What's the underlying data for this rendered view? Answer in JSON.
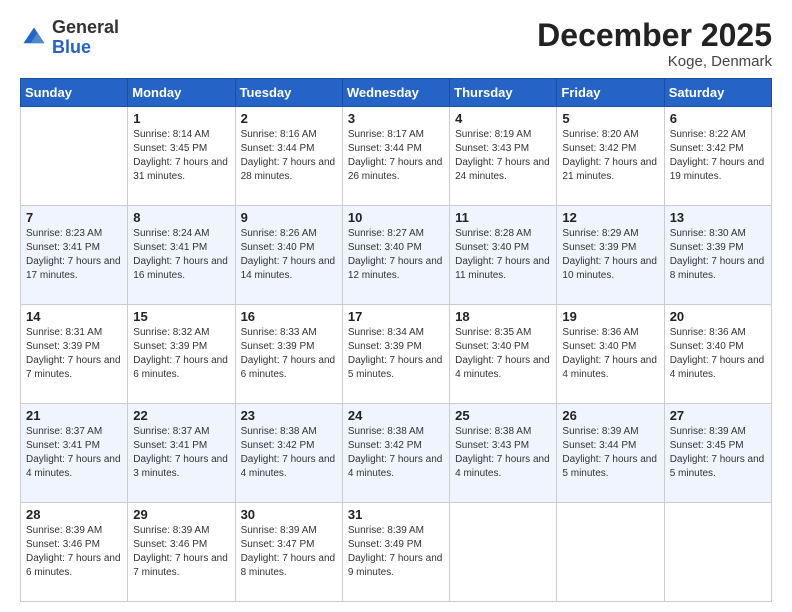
{
  "header": {
    "logo_general": "General",
    "logo_blue": "Blue",
    "month_title": "December 2025",
    "location": "Koge, Denmark"
  },
  "days_of_week": [
    "Sunday",
    "Monday",
    "Tuesday",
    "Wednesday",
    "Thursday",
    "Friday",
    "Saturday"
  ],
  "weeks": [
    [
      {
        "day": "",
        "sunrise": "",
        "sunset": "",
        "daylight": ""
      },
      {
        "day": "1",
        "sunrise": "Sunrise: 8:14 AM",
        "sunset": "Sunset: 3:45 PM",
        "daylight": "Daylight: 7 hours and 31 minutes."
      },
      {
        "day": "2",
        "sunrise": "Sunrise: 8:16 AM",
        "sunset": "Sunset: 3:44 PM",
        "daylight": "Daylight: 7 hours and 28 minutes."
      },
      {
        "day": "3",
        "sunrise": "Sunrise: 8:17 AM",
        "sunset": "Sunset: 3:44 PM",
        "daylight": "Daylight: 7 hours and 26 minutes."
      },
      {
        "day": "4",
        "sunrise": "Sunrise: 8:19 AM",
        "sunset": "Sunset: 3:43 PM",
        "daylight": "Daylight: 7 hours and 24 minutes."
      },
      {
        "day": "5",
        "sunrise": "Sunrise: 8:20 AM",
        "sunset": "Sunset: 3:42 PM",
        "daylight": "Daylight: 7 hours and 21 minutes."
      },
      {
        "day": "6",
        "sunrise": "Sunrise: 8:22 AM",
        "sunset": "Sunset: 3:42 PM",
        "daylight": "Daylight: 7 hours and 19 minutes."
      }
    ],
    [
      {
        "day": "7",
        "sunrise": "Sunrise: 8:23 AM",
        "sunset": "Sunset: 3:41 PM",
        "daylight": "Daylight: 7 hours and 17 minutes."
      },
      {
        "day": "8",
        "sunrise": "Sunrise: 8:24 AM",
        "sunset": "Sunset: 3:41 PM",
        "daylight": "Daylight: 7 hours and 16 minutes."
      },
      {
        "day": "9",
        "sunrise": "Sunrise: 8:26 AM",
        "sunset": "Sunset: 3:40 PM",
        "daylight": "Daylight: 7 hours and 14 minutes."
      },
      {
        "day": "10",
        "sunrise": "Sunrise: 8:27 AM",
        "sunset": "Sunset: 3:40 PM",
        "daylight": "Daylight: 7 hours and 12 minutes."
      },
      {
        "day": "11",
        "sunrise": "Sunrise: 8:28 AM",
        "sunset": "Sunset: 3:40 PM",
        "daylight": "Daylight: 7 hours and 11 minutes."
      },
      {
        "day": "12",
        "sunrise": "Sunrise: 8:29 AM",
        "sunset": "Sunset: 3:39 PM",
        "daylight": "Daylight: 7 hours and 10 minutes."
      },
      {
        "day": "13",
        "sunrise": "Sunrise: 8:30 AM",
        "sunset": "Sunset: 3:39 PM",
        "daylight": "Daylight: 7 hours and 8 minutes."
      }
    ],
    [
      {
        "day": "14",
        "sunrise": "Sunrise: 8:31 AM",
        "sunset": "Sunset: 3:39 PM",
        "daylight": "Daylight: 7 hours and 7 minutes."
      },
      {
        "day": "15",
        "sunrise": "Sunrise: 8:32 AM",
        "sunset": "Sunset: 3:39 PM",
        "daylight": "Daylight: 7 hours and 6 minutes."
      },
      {
        "day": "16",
        "sunrise": "Sunrise: 8:33 AM",
        "sunset": "Sunset: 3:39 PM",
        "daylight": "Daylight: 7 hours and 6 minutes."
      },
      {
        "day": "17",
        "sunrise": "Sunrise: 8:34 AM",
        "sunset": "Sunset: 3:39 PM",
        "daylight": "Daylight: 7 hours and 5 minutes."
      },
      {
        "day": "18",
        "sunrise": "Sunrise: 8:35 AM",
        "sunset": "Sunset: 3:40 PM",
        "daylight": "Daylight: 7 hours and 4 minutes."
      },
      {
        "day": "19",
        "sunrise": "Sunrise: 8:36 AM",
        "sunset": "Sunset: 3:40 PM",
        "daylight": "Daylight: 7 hours and 4 minutes."
      },
      {
        "day": "20",
        "sunrise": "Sunrise: 8:36 AM",
        "sunset": "Sunset: 3:40 PM",
        "daylight": "Daylight: 7 hours and 4 minutes."
      }
    ],
    [
      {
        "day": "21",
        "sunrise": "Sunrise: 8:37 AM",
        "sunset": "Sunset: 3:41 PM",
        "daylight": "Daylight: 7 hours and 4 minutes."
      },
      {
        "day": "22",
        "sunrise": "Sunrise: 8:37 AM",
        "sunset": "Sunset: 3:41 PM",
        "daylight": "Daylight: 7 hours and 3 minutes."
      },
      {
        "day": "23",
        "sunrise": "Sunrise: 8:38 AM",
        "sunset": "Sunset: 3:42 PM",
        "daylight": "Daylight: 7 hours and 4 minutes."
      },
      {
        "day": "24",
        "sunrise": "Sunrise: 8:38 AM",
        "sunset": "Sunset: 3:42 PM",
        "daylight": "Daylight: 7 hours and 4 minutes."
      },
      {
        "day": "25",
        "sunrise": "Sunrise: 8:38 AM",
        "sunset": "Sunset: 3:43 PM",
        "daylight": "Daylight: 7 hours and 4 minutes."
      },
      {
        "day": "26",
        "sunrise": "Sunrise: 8:39 AM",
        "sunset": "Sunset: 3:44 PM",
        "daylight": "Daylight: 7 hours and 5 minutes."
      },
      {
        "day": "27",
        "sunrise": "Sunrise: 8:39 AM",
        "sunset": "Sunset: 3:45 PM",
        "daylight": "Daylight: 7 hours and 5 minutes."
      }
    ],
    [
      {
        "day": "28",
        "sunrise": "Sunrise: 8:39 AM",
        "sunset": "Sunset: 3:46 PM",
        "daylight": "Daylight: 7 hours and 6 minutes."
      },
      {
        "day": "29",
        "sunrise": "Sunrise: 8:39 AM",
        "sunset": "Sunset: 3:46 PM",
        "daylight": "Daylight: 7 hours and 7 minutes."
      },
      {
        "day": "30",
        "sunrise": "Sunrise: 8:39 AM",
        "sunset": "Sunset: 3:47 PM",
        "daylight": "Daylight: 7 hours and 8 minutes."
      },
      {
        "day": "31",
        "sunrise": "Sunrise: 8:39 AM",
        "sunset": "Sunset: 3:49 PM",
        "daylight": "Daylight: 7 hours and 9 minutes."
      },
      {
        "day": "",
        "sunrise": "",
        "sunset": "",
        "daylight": ""
      },
      {
        "day": "",
        "sunrise": "",
        "sunset": "",
        "daylight": ""
      },
      {
        "day": "",
        "sunrise": "",
        "sunset": "",
        "daylight": ""
      }
    ]
  ]
}
